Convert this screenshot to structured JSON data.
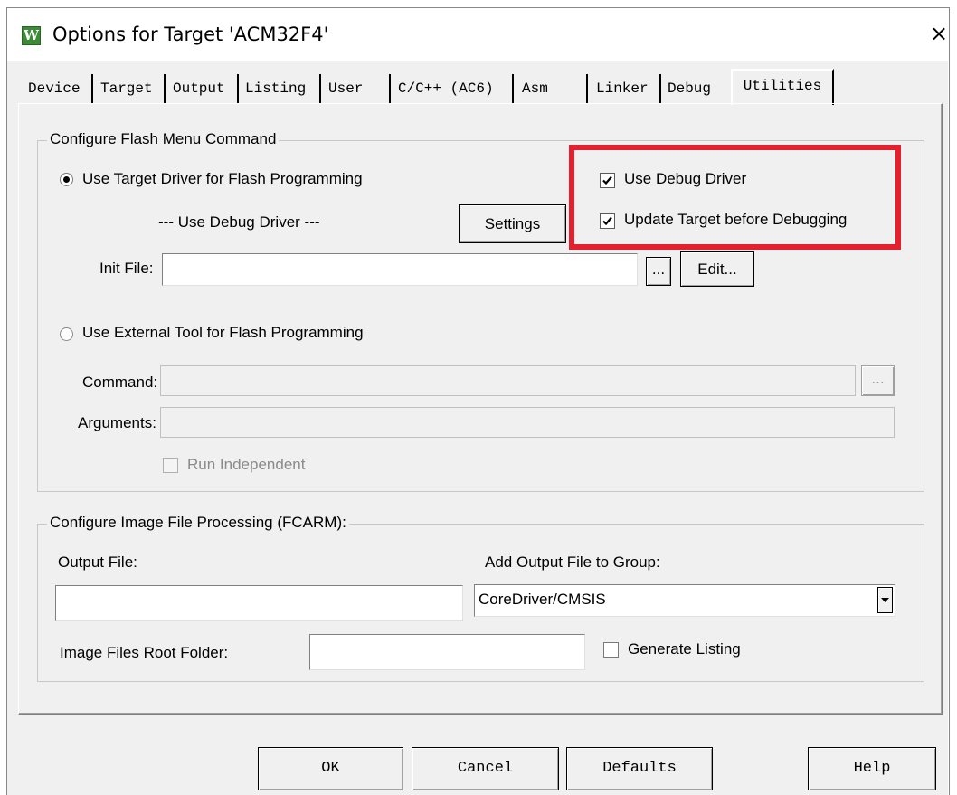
{
  "window": {
    "title": "Options for Target 'ACM32F4'",
    "icon_letter": "W",
    "close_glyph": "×"
  },
  "tabs": [
    {
      "label": "Device"
    },
    {
      "label": "Target"
    },
    {
      "label": "Output"
    },
    {
      "label": "Listing"
    },
    {
      "label": "User"
    },
    {
      "label": "C/C++ (AC6)"
    },
    {
      "label": "Asm"
    },
    {
      "label": "Linker"
    },
    {
      "label": "Debug"
    },
    {
      "label": "Utilities",
      "active": true
    }
  ],
  "flash": {
    "group_label": "Configure Flash Menu Command",
    "use_target_driver": {
      "label": "Use Target Driver for Flash Programming",
      "selected": true
    },
    "driver_name": "--- Use Debug Driver ---",
    "settings_button": "Settings",
    "use_debug_driver": {
      "label": "Use Debug Driver",
      "checked": true
    },
    "update_target": {
      "label": "Update Target before Debugging",
      "checked": true
    },
    "init_file": {
      "label": "Init File:",
      "value": ""
    },
    "browse_button": "...",
    "edit_button": "Edit...",
    "use_external_tool": {
      "label": "Use External Tool for Flash Programming",
      "selected": false
    },
    "command": {
      "label": "Command:",
      "value": ""
    },
    "command_browse": "...",
    "arguments": {
      "label": "Arguments:",
      "value": ""
    },
    "run_independent": {
      "label": "Run Independent",
      "checked": false,
      "enabled": false
    }
  },
  "image": {
    "group_label": "Configure Image File Processing (FCARM):",
    "output_file": {
      "label": "Output File:",
      "value": ""
    },
    "add_output_group": {
      "label": "Add Output File  to Group:",
      "selected": "CoreDriver/CMSIS"
    },
    "root_folder": {
      "label": "Image Files Root Folder:",
      "value": ""
    },
    "generate_listing": {
      "label": "Generate Listing",
      "checked": false
    }
  },
  "buttons": {
    "ok": "OK",
    "cancel": "Cancel",
    "defaults": "Defaults",
    "help": "Help"
  },
  "colors": {
    "highlight": "#e5202e",
    "dialog_bg": "#f0f0f0",
    "app_icon": "#3d8b37"
  }
}
